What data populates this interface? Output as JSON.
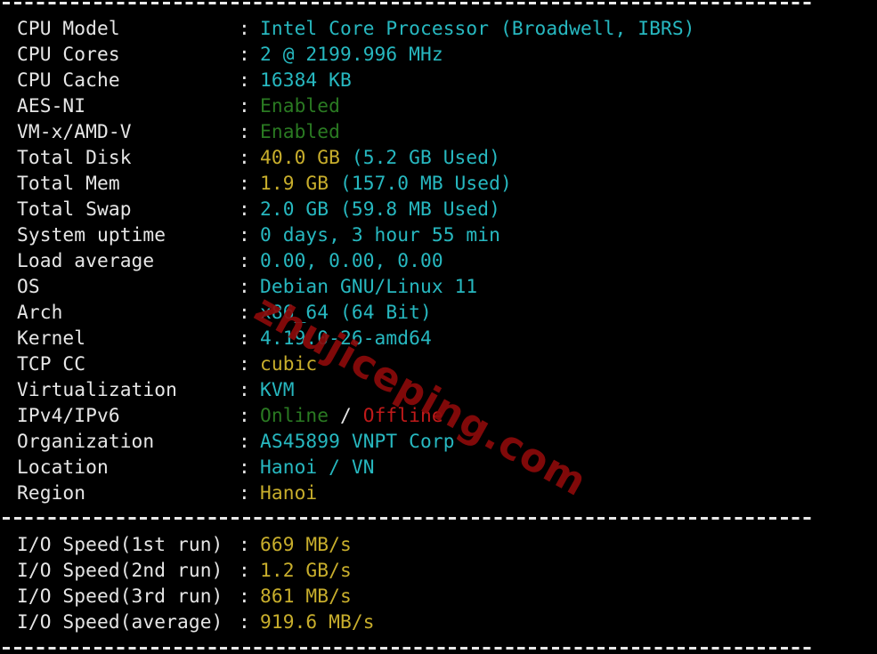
{
  "terminal": {
    "divider_char": "-",
    "system_info": [
      {
        "label": "CPU Model",
        "parts": [
          {
            "text": "Intel Core Processor (Broadwell, IBRS)",
            "color": "cyan"
          }
        ]
      },
      {
        "label": "CPU Cores",
        "parts": [
          {
            "text": "2 @ 2199.996 MHz",
            "color": "cyan"
          }
        ]
      },
      {
        "label": "CPU Cache",
        "parts": [
          {
            "text": "16384 KB",
            "color": "cyan"
          }
        ]
      },
      {
        "label": "AES-NI",
        "parts": [
          {
            "text": "Enabled",
            "color": "green"
          }
        ]
      },
      {
        "label": "VM-x/AMD-V",
        "parts": [
          {
            "text": "Enabled",
            "color": "green"
          }
        ]
      },
      {
        "label": "Total Disk",
        "parts": [
          {
            "text": "40.0 GB",
            "color": "yellow"
          },
          {
            "text": " (5.2 GB Used)",
            "color": "cyan"
          }
        ]
      },
      {
        "label": "Total Mem",
        "parts": [
          {
            "text": "1.9 GB",
            "color": "yellow"
          },
          {
            "text": " (157.0 MB Used)",
            "color": "cyan"
          }
        ]
      },
      {
        "label": "Total Swap",
        "parts": [
          {
            "text": "2.0 GB (59.8 MB Used)",
            "color": "cyan"
          }
        ]
      },
      {
        "label": "System uptime",
        "parts": [
          {
            "text": "0 days, 3 hour 55 min",
            "color": "cyan"
          }
        ]
      },
      {
        "label": "Load average",
        "parts": [
          {
            "text": "0.00, 0.00, 0.00",
            "color": "cyan"
          }
        ]
      },
      {
        "label": "OS",
        "parts": [
          {
            "text": "Debian GNU/Linux 11",
            "color": "cyan"
          }
        ]
      },
      {
        "label": "Arch",
        "parts": [
          {
            "text": "x86_64 (64 Bit)",
            "color": "cyan"
          }
        ]
      },
      {
        "label": "Kernel",
        "parts": [
          {
            "text": "4.19.0-26-amd64",
            "color": "cyan"
          }
        ]
      },
      {
        "label": "TCP CC",
        "parts": [
          {
            "text": "cubic",
            "color": "yellow"
          }
        ]
      },
      {
        "label": "Virtualization",
        "parts": [
          {
            "text": "KVM",
            "color": "cyan"
          }
        ]
      },
      {
        "label": "IPv4/IPv6",
        "parts": [
          {
            "text": "Online",
            "color": "green"
          },
          {
            "text": " / ",
            "color": "white"
          },
          {
            "text": "Offline",
            "color": "red"
          }
        ]
      },
      {
        "label": "Organization",
        "parts": [
          {
            "text": "AS45899 VNPT Corp",
            "color": "cyan"
          }
        ]
      },
      {
        "label": "Location",
        "parts": [
          {
            "text": "Hanoi / VN",
            "color": "cyan"
          }
        ]
      },
      {
        "label": "Region",
        "parts": [
          {
            "text": "Hanoi",
            "color": "yellow"
          }
        ]
      }
    ],
    "io_speed": [
      {
        "label": "I/O Speed(1st run)",
        "parts": [
          {
            "text": "669 MB/s",
            "color": "yellow"
          }
        ]
      },
      {
        "label": "I/O Speed(2nd run)",
        "parts": [
          {
            "text": "1.2 GB/s",
            "color": "yellow"
          }
        ]
      },
      {
        "label": "I/O Speed(3rd run)",
        "parts": [
          {
            "text": "861 MB/s",
            "color": "yellow"
          }
        ]
      },
      {
        "label": "I/O Speed(average)",
        "parts": [
          {
            "text": "919.6 MB/s",
            "color": "yellow"
          }
        ]
      }
    ],
    "separator": ":",
    "watermark": "zhujiceping.com"
  },
  "colors": {
    "background": "#000000",
    "label": "#e6e6e6",
    "cyan": "#27b8c0",
    "yellow": "#c8ae2c",
    "green": "#2a7a22",
    "red": "#c01a1a",
    "watermark": "#8b0a0a"
  }
}
